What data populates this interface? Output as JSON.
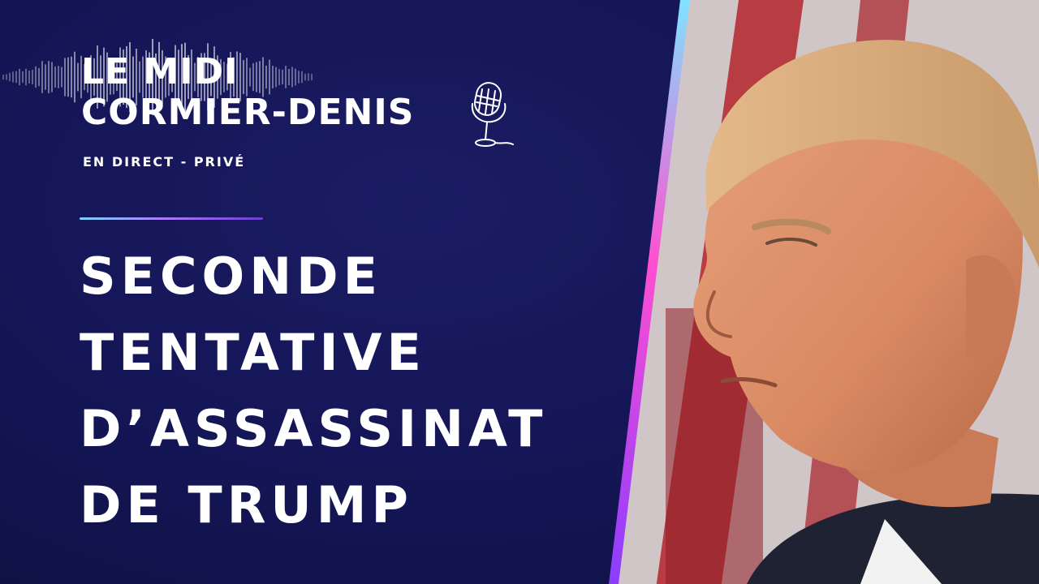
{
  "show": {
    "title_line1": "LE MIDI",
    "title_line2": "CORMIER-DENIS",
    "subtitle": "EN DIRECT - PRIVÉ"
  },
  "headline": {
    "lines": [
      "SECONDE",
      "TENTATIVE",
      "D’ASSASSINAT",
      "DE TRUMP"
    ]
  },
  "icons": {
    "microphone": "microphone-icon",
    "waveform": "audio-waveform"
  },
  "colors": {
    "background": "#151658",
    "text": "#ffffff",
    "accent_cyan": "#7fe3ff",
    "accent_pink": "#ff4fd1",
    "accent_purple": "#8a3dff"
  }
}
